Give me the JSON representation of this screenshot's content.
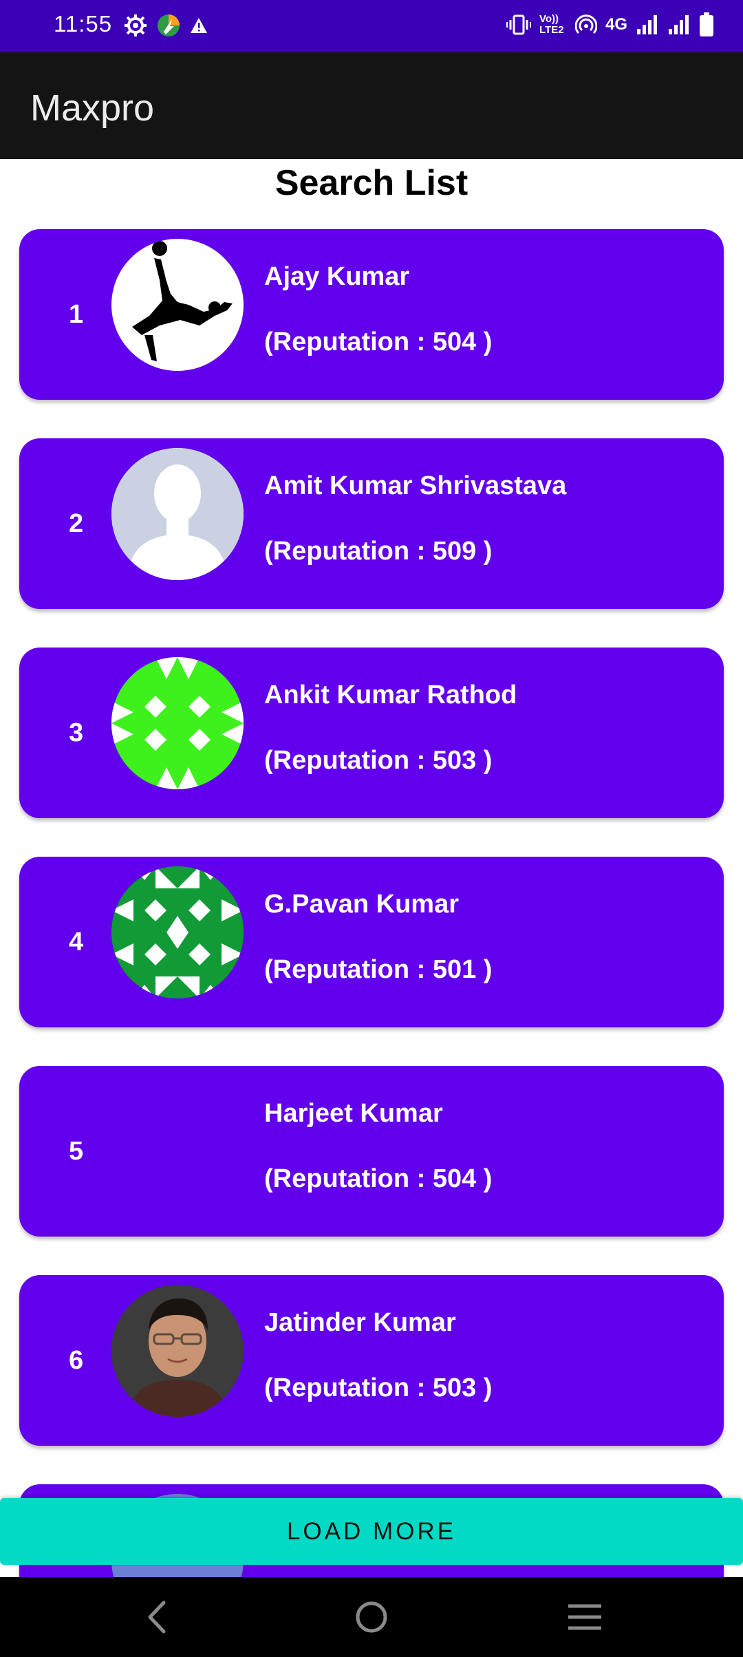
{
  "status_bar": {
    "time": "11:55",
    "network_label": "4G",
    "volte_label": "Vo)) LTE2",
    "icons": [
      "gear-icon",
      "app-badge-icon",
      "warning-icon",
      "vibrate-icon",
      "volte-icon",
      "hotspot-icon",
      "signal-4g-icon",
      "signal-icon",
      "battery-icon"
    ]
  },
  "app_bar": {
    "title": "Maxpro"
  },
  "page": {
    "title": "Search List"
  },
  "list": {
    "items": [
      {
        "rank": "1",
        "name": "Ajay Kumar",
        "reputation": "(Reputation : 504 )",
        "avatar": "footballer-silhouette"
      },
      {
        "rank": "2",
        "name": "Amit Kumar Shrivastava",
        "reputation": "(Reputation : 509 )",
        "avatar": "default-person"
      },
      {
        "rank": "3",
        "name": "Ankit Kumar Rathod",
        "reputation": "(Reputation : 503 )",
        "avatar": "green-identicon"
      },
      {
        "rank": "4",
        "name": "G.Pavan Kumar",
        "reputation": "(Reputation : 501 )",
        "avatar": "dark-green-identicon"
      },
      {
        "rank": "5",
        "name": "Harjeet Kumar",
        "reputation": "(Reputation : 504 )",
        "avatar": "none"
      },
      {
        "rank": "6",
        "name": "Jatinder Kumar",
        "reputation": "(Reputation : 503 )",
        "avatar": "photo"
      }
    ]
  },
  "load_more": {
    "label": "LOAD MORE"
  },
  "nav": {
    "icons": [
      "back-icon",
      "home-icon",
      "menu-icon"
    ]
  },
  "colors": {
    "status_bar": "#3c00b6",
    "app_bar": "#141414",
    "card": "#6200ee",
    "load_more": "#03dac5"
  }
}
